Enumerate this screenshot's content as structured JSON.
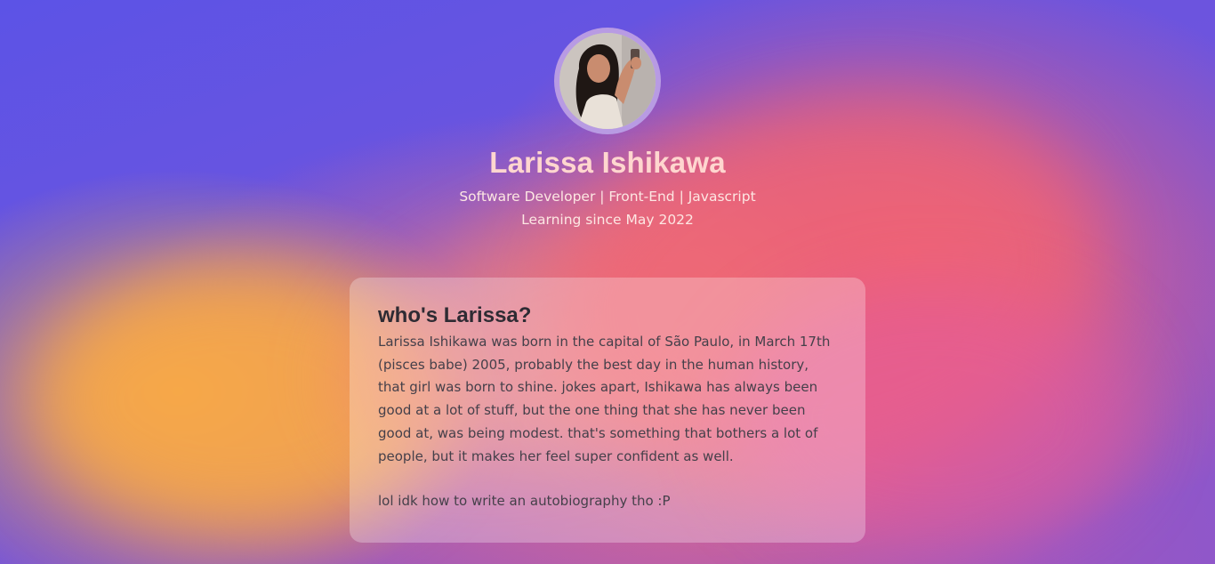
{
  "profile": {
    "name": "Larissa Ishikawa",
    "subtitle": "Software Developer | Front-End | Javascript",
    "learning": "Learning since May 2022",
    "avatar_alt": "profile photo"
  },
  "about": {
    "heading": "who's Larissa?",
    "paragraph1": "Larissa Ishikawa was born in the capital of São Paulo, in March 17th (pisces babe) 2005, probably the best day in the human history, that girl was born to shine. jokes apart, Ishikawa has always been good at a lot of stuff, but the one thing that she has never been good at, was being modest. that's something that bothers a lot of people, but it makes her feel super confident as well.",
    "paragraph2": "lol idk how to write an autobiography tho :P"
  },
  "colors": {
    "name": "#ffd6cf",
    "text_light": "#fde7e3",
    "card_text": "#45404a",
    "avatar_ring": "#b89be3"
  }
}
